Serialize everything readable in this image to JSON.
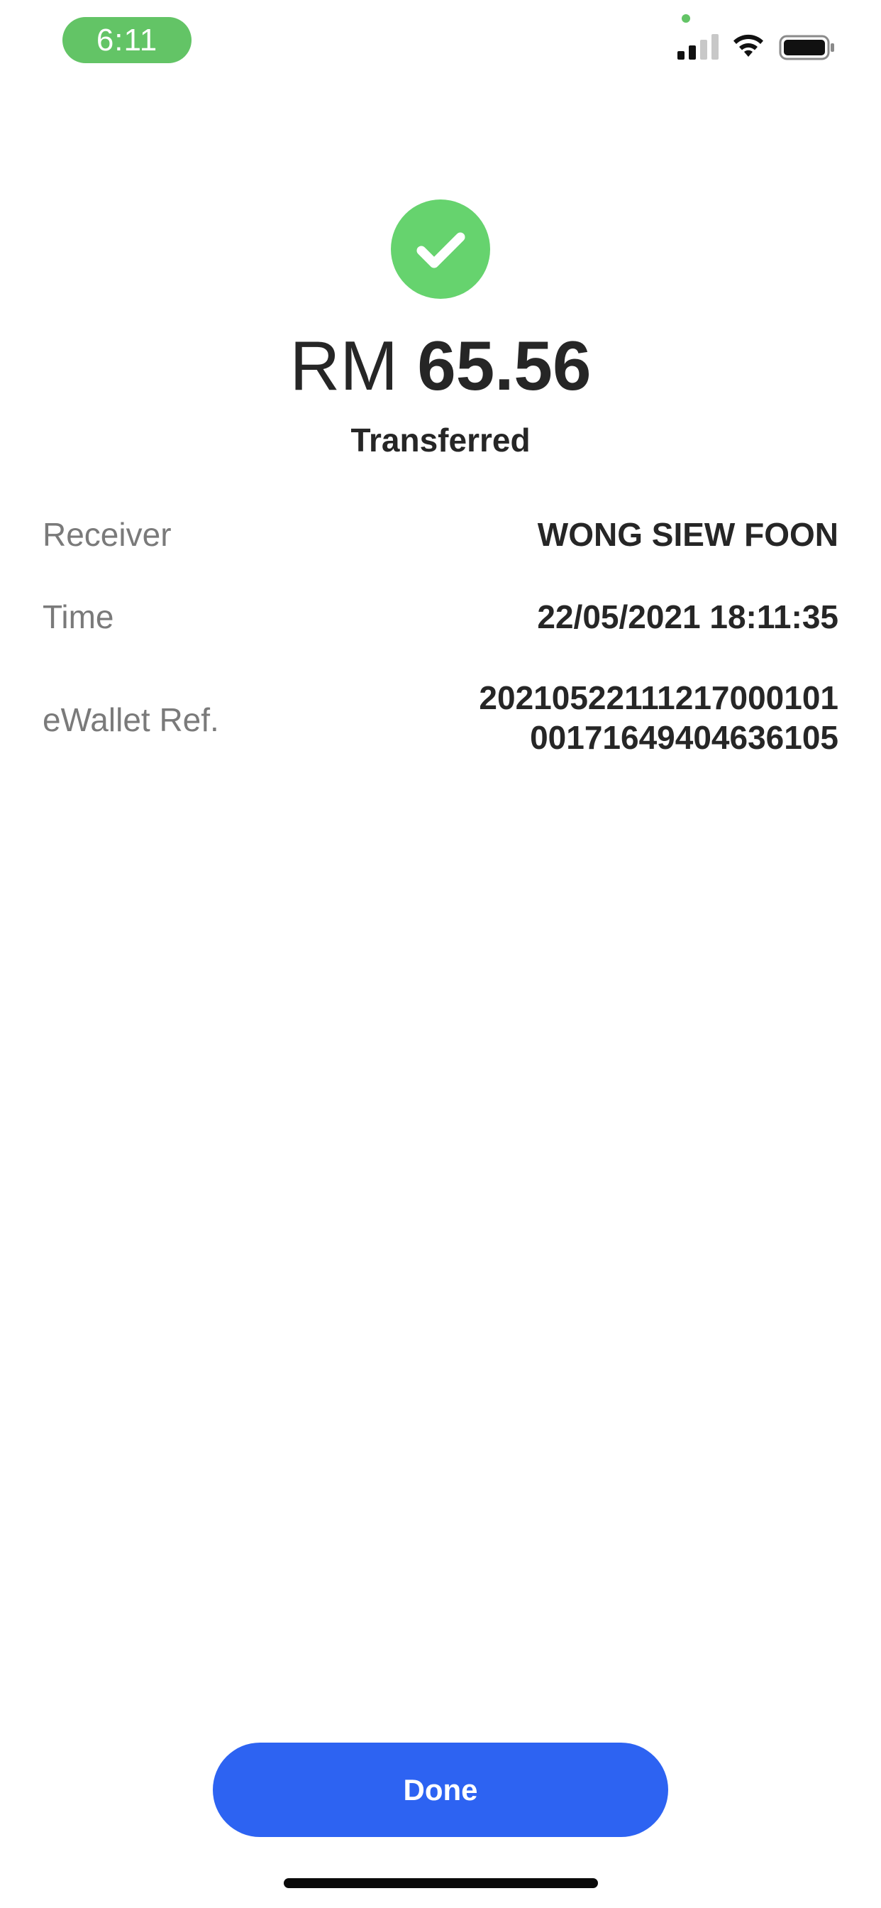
{
  "status_bar": {
    "time": "6:11",
    "icons": [
      "signal-icon",
      "wifi-icon",
      "battery-icon"
    ],
    "accent": "#63c466"
  },
  "transfer": {
    "icon": "check-icon",
    "currency": "RM",
    "amount": "65.56",
    "status": "Transferred",
    "success_color": "#66d36e"
  },
  "details": {
    "receiver_label": "Receiver",
    "receiver_value": "WONG SIEW FOON",
    "time_label": "Time",
    "time_value": "22/05/2021 18:11:35",
    "ref_label": "eWallet Ref.",
    "ref_line1": "20210522111217000101",
    "ref_line2": "00171649404636105"
  },
  "actions": {
    "done_label": "Done",
    "done_color": "#2d63f2"
  }
}
